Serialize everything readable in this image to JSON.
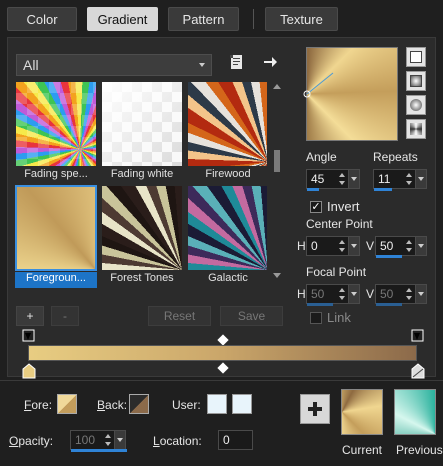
{
  "tabs": [
    {
      "label": "Color"
    },
    {
      "label": "Gradient",
      "active": true
    },
    {
      "label": "Pattern"
    },
    {
      "label": "Texture"
    }
  ],
  "category": {
    "selected": "All"
  },
  "presets": [
    {
      "name": "Fading spe...",
      "selected": false
    },
    {
      "name": "Fading white",
      "selected": false
    },
    {
      "name": "Firewood",
      "selected": false
    },
    {
      "name": "Foregroun...",
      "selected": true
    },
    {
      "name": "Forest Tones",
      "selected": false
    },
    {
      "name": "Galactic",
      "selected": false
    }
  ],
  "preset_buttons": {
    "add": "+",
    "remove": "-",
    "reset": "Reset",
    "save": "Save"
  },
  "angle": {
    "label": "Angle",
    "value": "45"
  },
  "repeats": {
    "label": "Repeats",
    "value": "11"
  },
  "invert": {
    "label": "Invert",
    "checked": true
  },
  "center_point": {
    "label": "Center Point",
    "h_label": "H",
    "h_value": "0",
    "v_label": "V",
    "v_value": "50"
  },
  "focal_point": {
    "label": "Focal Point",
    "h_label": "H",
    "h_value": "50",
    "v_label": "V",
    "v_value": "50"
  },
  "link": {
    "label": "Link",
    "checked": false
  },
  "fore": {
    "label": "Fore:",
    "color": "#d9bd71"
  },
  "back": {
    "label": "Back:",
    "color": "#8b6a4a"
  },
  "user": {
    "label": "User:"
  },
  "opacity": {
    "label": "Opacity:",
    "value": "100"
  },
  "location": {
    "label": "Location:",
    "value": "0"
  },
  "current_label": "Current",
  "previous_label": "Previous",
  "colors": {
    "accent": "#1d74c7",
    "gold": "#e6c97e",
    "brown": "#8b6a4a"
  }
}
